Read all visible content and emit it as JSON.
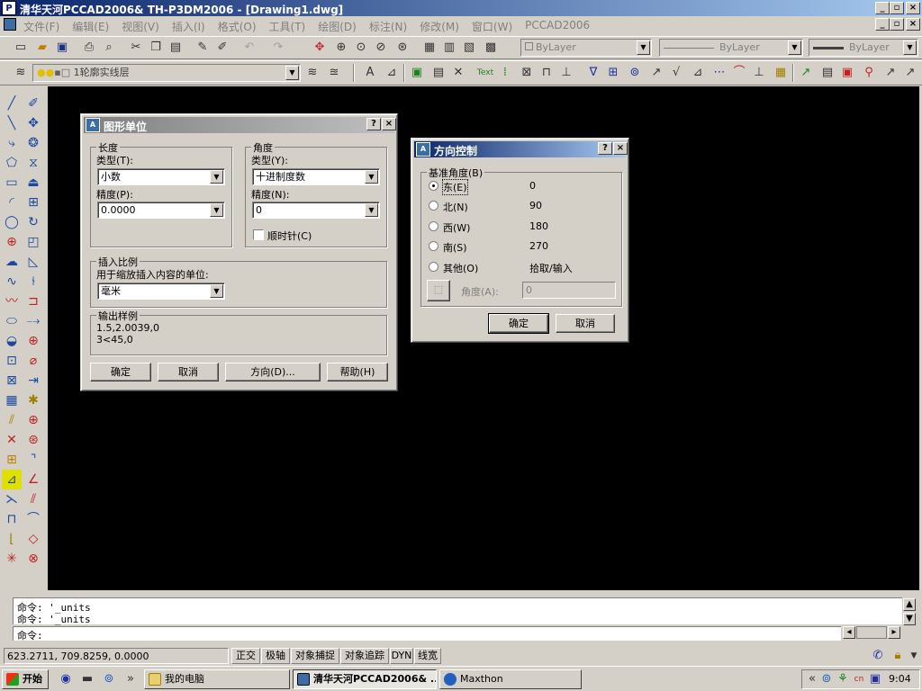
{
  "window": {
    "title": "清华天河PCCAD2006& TH-P3DM2006 - [Drawing1.dwg]",
    "app_icon": "pccad-logo-icon",
    "caption_buttons": [
      "_",
      "▫",
      "×"
    ]
  },
  "menu": {
    "items": [
      "文件(F)",
      "编辑(E)",
      "视图(V)",
      "插入(I)",
      "格式(O)",
      "工具(T)",
      "绘图(D)",
      "标注(N)",
      "修改(M)",
      "窗口(W)",
      "PCCAD2006"
    ]
  },
  "properties_toolbar": {
    "color": "ByLayer",
    "linetype": "ByLayer",
    "lineweight": "ByLayer"
  },
  "layer_toolbar": {
    "layer_name": "1轮廓实线层"
  },
  "units_dialog": {
    "title": "图形单位",
    "length": {
      "group_label": "长度",
      "type_label": "类型(T):",
      "type_value": "小数",
      "precision_label": "精度(P):",
      "precision_value": "0.0000"
    },
    "angle": {
      "group_label": "角度",
      "type_label": "类型(Y):",
      "type_value": "十进制度数",
      "precision_label": "精度(N):",
      "precision_value": "0",
      "clockwise_label": "顺时针(C)",
      "clockwise_checked": false
    },
    "insertion": {
      "group_label": "插入比例",
      "units_label": "用于缩放插入内容的单位:",
      "units_value": "毫米"
    },
    "sample": {
      "group_label": "输出样例",
      "line1": "1.5,2.0039,0",
      "line2": "3<45,0"
    },
    "buttons": {
      "ok": "确定",
      "cancel": "取消",
      "direction": "方向(D)...",
      "help": "帮助(H)"
    }
  },
  "direction_dialog": {
    "title": "方向控制",
    "group_label": "基准角度(B)",
    "options": [
      {
        "label": "东(E)",
        "value": "0",
        "selected": true
      },
      {
        "label": "北(N)",
        "value": "90",
        "selected": false
      },
      {
        "label": "西(W)",
        "value": "180",
        "selected": false
      },
      {
        "label": "南(S)",
        "value": "270",
        "selected": false
      },
      {
        "label": "其他(O)",
        "value": "拾取/输入",
        "selected": false
      }
    ],
    "angle_label": "角度(A):",
    "angle_value": "0",
    "buttons": {
      "ok": "确定",
      "cancel": "取消"
    }
  },
  "command": {
    "history": [
      "命令: '_units",
      "命令: '_units"
    ],
    "prompt": "命令:"
  },
  "status": {
    "coordinates": "623.2711, 709.8259, 0.0000",
    "toggles": [
      "正交",
      "极轴",
      "对象捕捉",
      "对象追踪",
      "DYN",
      "线宽"
    ]
  },
  "taskbar": {
    "start_label": "开始",
    "tasks": [
      {
        "label": "我的电脑",
        "active": false
      },
      {
        "label": "清华天河PCCAD2006& ...",
        "active": true
      },
      {
        "label": "Maxthon",
        "active": false
      }
    ],
    "clock": "9:04",
    "chevron": "»"
  },
  "colors": {
    "titlebar_active": "#0a246a",
    "face": "#d4d0c8",
    "drawing_bg": "#000000"
  }
}
